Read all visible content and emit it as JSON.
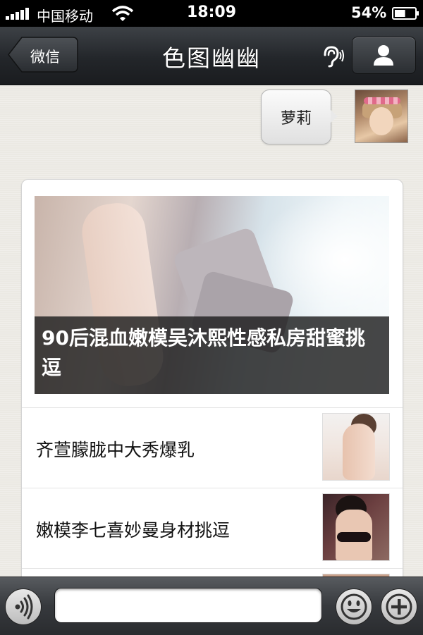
{
  "status_bar": {
    "carrier": "中国移动",
    "time": "18:09",
    "battery_percent": "54%",
    "battery_level": 0.54,
    "signal_icon": "signal-bars-icon",
    "wifi_icon": "wifi-icon",
    "battery_icon": "battery-icon"
  },
  "nav": {
    "back_label": "微信",
    "title": "色图幽幽",
    "ear_icon": "ear-icon",
    "profile_icon": "person-icon"
  },
  "chat": {
    "sent_message": "萝莉",
    "news": {
      "hero_title": "90后混血嫩模吴沐熙性感私房甜蜜挑逗",
      "items": [
        {
          "title": "齐萱朦胧中大秀爆乳"
        },
        {
          "title": "嫩模李七喜妙曼身材挑逗"
        }
      ]
    }
  },
  "input_bar": {
    "voice_icon": "voice-icon",
    "text_value": "",
    "emoji_icon": "smiley-icon",
    "plus_icon": "plus-icon"
  }
}
